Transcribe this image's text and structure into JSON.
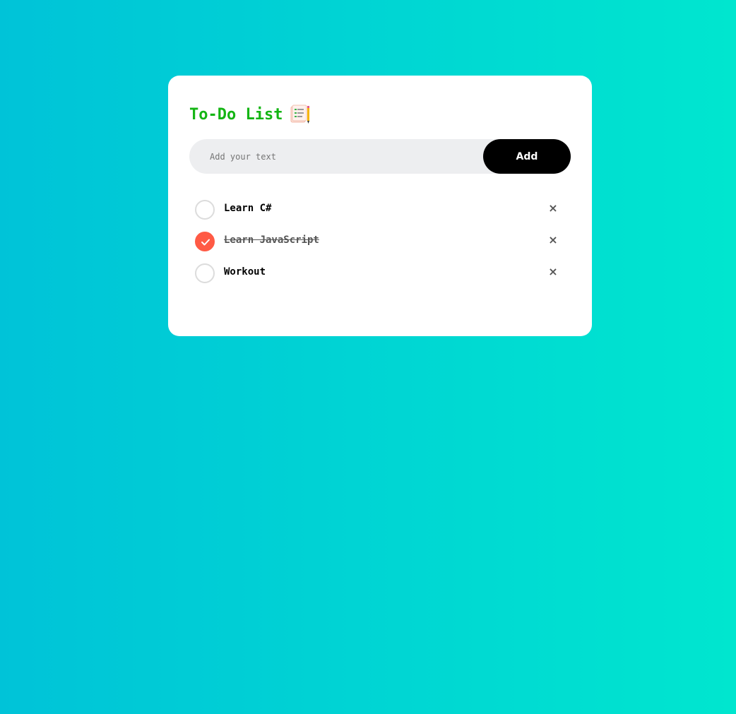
{
  "app": {
    "title": "To-Do List",
    "title_icon": "notepad-icon",
    "colors": {
      "title": "#14b514",
      "accent_checked": "#ff5a45",
      "button_bg": "#000000",
      "input_bg": "#edeef0",
      "background_gradient_start": "#00c3d8",
      "background_gradient_end": "#00e6cf"
    }
  },
  "input": {
    "placeholder": "Add your text",
    "value": ""
  },
  "add_button": {
    "label": "Add"
  },
  "todos": [
    {
      "text": "Learn C#",
      "checked": false,
      "remove_label": "×"
    },
    {
      "text": "Learn JavaScript",
      "checked": true,
      "remove_label": "×"
    },
    {
      "text": "Workout",
      "checked": false,
      "remove_label": "×"
    }
  ]
}
